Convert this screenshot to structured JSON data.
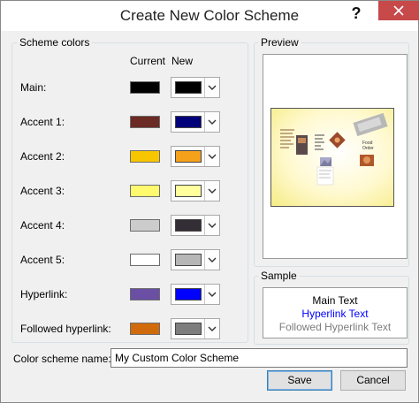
{
  "window": {
    "title": "Create New Color Scheme",
    "help_glyph": "?"
  },
  "scheme_colors": {
    "legend": "Scheme colors",
    "col_current": "Current",
    "col_new": "New",
    "rows": [
      {
        "label": "Main:",
        "current": "#000000",
        "new": "#000000"
      },
      {
        "label": "Accent 1:",
        "current": "#6b2a23",
        "new": "#00007a"
      },
      {
        "label": "Accent 2:",
        "current": "#f7c600",
        "new": "#f6a11a"
      },
      {
        "label": "Accent 3:",
        "current": "#fff96e",
        "new": "#ffff9d"
      },
      {
        "label": "Accent 4:",
        "current": "#cccccc",
        "new": "#332d35"
      },
      {
        "label": "Accent 5:",
        "current": "#ffffff",
        "new": "#b6b6b6"
      },
      {
        "label": "Hyperlink:",
        "current": "#6a4fa4",
        "new": "#0000ff"
      },
      {
        "label": "Followed hyperlink:",
        "current": "#d16a0a",
        "new": "#7d7d7d"
      }
    ]
  },
  "preview": {
    "legend": "Preview"
  },
  "sample": {
    "legend": "Sample",
    "main_text": "Main Text",
    "hyperlink_text": "Hyperlink Text",
    "followed_text": "Followed Hyperlink Text",
    "main_color": "#000000",
    "hyperlink_color": "#0000ff",
    "followed_color": "#7d7d7d"
  },
  "name_field": {
    "label": "Color scheme name:",
    "value": "My Custom Color Scheme"
  },
  "buttons": {
    "save": "Save",
    "cancel": "Cancel"
  },
  "icons": {
    "close": "close-icon",
    "dropdown": "chevron-down-icon"
  }
}
